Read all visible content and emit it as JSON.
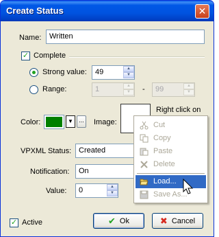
{
  "window": {
    "title": "Create Status",
    "close_glyph": "✕"
  },
  "form": {
    "name_label": "Name:",
    "name_value": "Written",
    "complete_label": "Complete",
    "complete_checked": true,
    "strong_label": "Strong value:",
    "strong_value": "49",
    "range_label": "Range:",
    "range_from": "1",
    "range_dash": "-",
    "range_to": "99",
    "color_label": "Color:",
    "color_value": "#008000",
    "color_dropdown_glyph": "▼",
    "color_more": "...",
    "image_label": "Image:",
    "image_hint": "Right click on",
    "vpxml_label": "VPXML Status:",
    "vpxml_value": "Created",
    "notification_label": "Notification:",
    "notification_value": "On",
    "value_label": "Value:",
    "value_value": "0",
    "active_label": "Active",
    "active_checked": true
  },
  "buttons": {
    "ok": "Ok",
    "cancel": "Cancel"
  },
  "context_menu": {
    "items": [
      {
        "label": "Cut",
        "icon": "scissors-icon",
        "enabled": false
      },
      {
        "label": "Copy",
        "icon": "copy-icon",
        "enabled": false
      },
      {
        "label": "Paste",
        "icon": "paste-icon",
        "enabled": false
      },
      {
        "label": "Delete",
        "icon": "delete-x-icon",
        "enabled": false
      },
      {
        "label": "Load...",
        "icon": "open-folder-icon",
        "enabled": true,
        "highlighted": true
      },
      {
        "label": "Save As...",
        "icon": "floppy-disk-icon",
        "enabled": false
      }
    ]
  },
  "colors": {
    "accent": "#316AC5",
    "titlebar": "#0054E3",
    "check": "#21A121"
  }
}
